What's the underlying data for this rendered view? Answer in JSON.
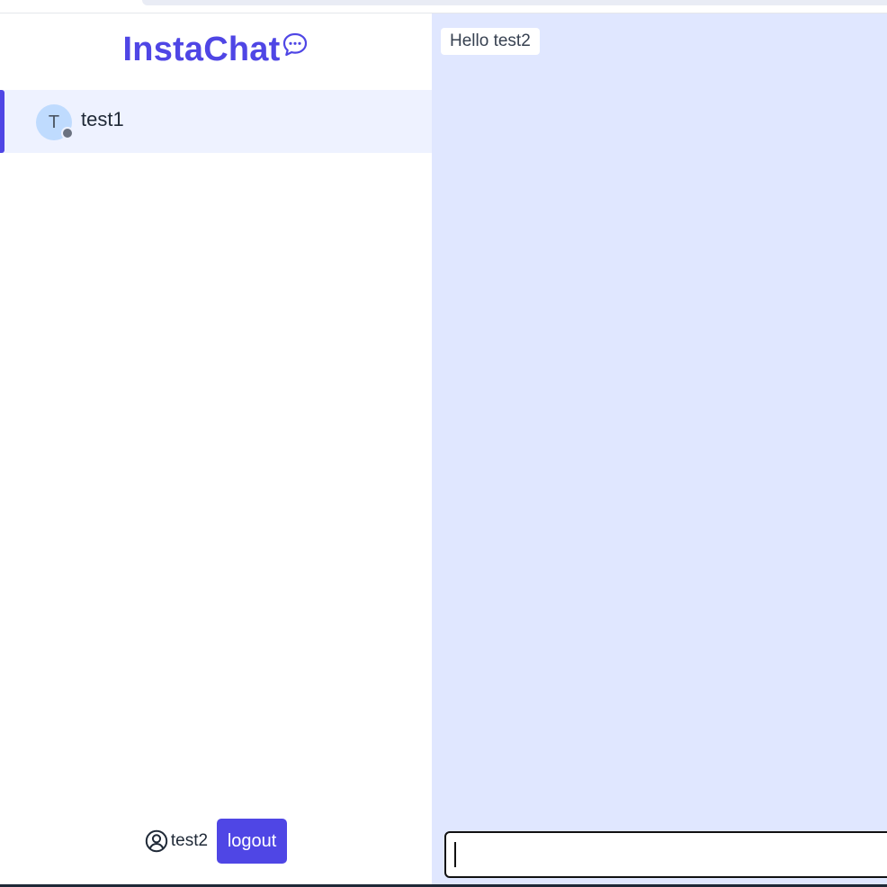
{
  "app": {
    "title": "InstaChat",
    "brand_icon": "chat-bubble-dots-icon",
    "accent_color": "#4f46e5"
  },
  "sidebar": {
    "chats": [
      {
        "avatar_initial": "T",
        "name": "test1",
        "status": "offline",
        "status_color": "#6b7280"
      }
    ]
  },
  "current_user": {
    "icon": "user-circle-icon",
    "name": "test2",
    "logout_label": "logout"
  },
  "conversation": {
    "messages": [
      {
        "text": "Hello test2"
      }
    ],
    "input_value": "",
    "background_color": "#e0e7ff"
  }
}
